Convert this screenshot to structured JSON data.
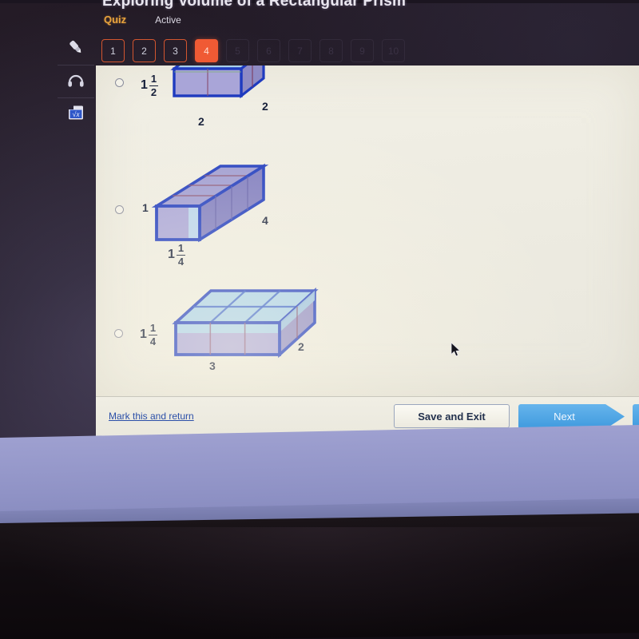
{
  "quiz": {
    "title": "Exploring Volume of a Rectangular Prism",
    "label": "Quiz",
    "status": "Active",
    "question_numbers": [
      {
        "n": "1",
        "state": "done"
      },
      {
        "n": "2",
        "state": "done"
      },
      {
        "n": "3",
        "state": "done"
      },
      {
        "n": "4",
        "state": "current"
      },
      {
        "n": "5",
        "state": "future"
      },
      {
        "n": "6",
        "state": "future"
      },
      {
        "n": "7",
        "state": "future"
      },
      {
        "n": "8",
        "state": "future"
      },
      {
        "n": "9",
        "state": "future"
      },
      {
        "n": "10",
        "state": "future"
      }
    ]
  },
  "toolbar": {
    "items": [
      {
        "icon": "highlighter-icon",
        "name": "Highlighter"
      },
      {
        "icon": "headphones-icon",
        "name": "Read aloud"
      },
      {
        "icon": "calculator-icon",
        "name": "Calculator"
      }
    ]
  },
  "options": [
    {
      "id": "option-1",
      "selected": false,
      "height_whole": "1",
      "height_num": "1",
      "height_den": "2",
      "width_label": "2",
      "depth_label": "2",
      "top_divisions": 2,
      "cut_off_top": true
    },
    {
      "id": "option-2",
      "selected": false,
      "height_label": "1",
      "width_whole": "1",
      "width_num": "1",
      "width_den": "4",
      "depth_label": "4",
      "top_divisions": 4
    },
    {
      "id": "option-3",
      "selected": false,
      "height_whole": "1",
      "height_num": "1",
      "height_den": "4",
      "width_label": "3",
      "depth_label": "2",
      "top_cols": 3,
      "top_rows": 2
    }
  ],
  "actions": {
    "mark_and_return": "Mark this and return",
    "save_and_exit": "Save and Exit",
    "next": "Next"
  },
  "colors": {
    "accent_orange": "#f05a34",
    "quiz_label": "#e8a33d",
    "link_blue": "#2b4fa8",
    "next_blue": "#3f9ade",
    "prism_edge": "#1f3bbf",
    "prism_face_front": "#a9a5d8",
    "prism_face_top": "#a8d0ea"
  }
}
